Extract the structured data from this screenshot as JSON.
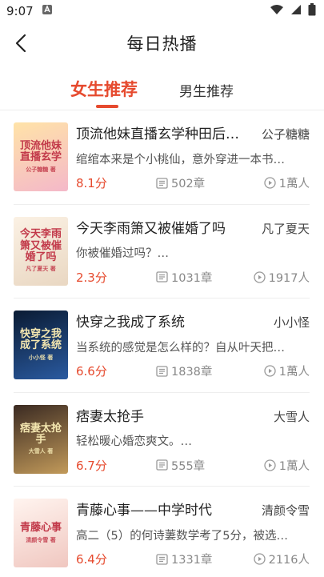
{
  "status": {
    "time": "9:07"
  },
  "header": {
    "title": "每日热播"
  },
  "tabs": [
    {
      "label": "女生推荐",
      "active": true
    },
    {
      "label": "男生推荐",
      "active": false
    }
  ],
  "books": [
    {
      "title": "顶流他妹直播玄学种田后…",
      "author": "公子糖糖",
      "desc": "绾绾本来是个小桃仙，意外穿进一本书…",
      "score": "8.1分",
      "chapters": "502章",
      "reads": "1萬人",
      "cover_title": "顶流他妹直播玄学",
      "cover_sub": "公子糖糖 著",
      "cover_colors": [
        "#ffe3a8",
        "#f4b8c9"
      ]
    },
    {
      "title": "今天李雨箫又被催婚了吗",
      "author": "凡了夏天",
      "desc": "你被催婚过吗？…",
      "score": "2.3分",
      "chapters": "1031章",
      "reads": "1917人",
      "cover_title": "今天李雨箫又被催婚了吗",
      "cover_sub": "凡了夏天 著",
      "cover_colors": [
        "#fbf1e4",
        "#e9d7c2"
      ]
    },
    {
      "title": "快穿之我成了系统",
      "author": "小小怪",
      "desc": "当系统的感觉是怎么样的？自从叶天把…",
      "score": "6.6分",
      "chapters": "1838章",
      "reads": "1萬人",
      "cover_title": "快穿之我成了系统",
      "cover_sub": "小小怪 著",
      "cover_colors": [
        "#0a1b33",
        "#2a5aa0"
      ]
    },
    {
      "title": "痞妻太抢手",
      "author": "大雪人",
      "desc": "轻松暖心婚恋爽文。…",
      "score": "6.7分",
      "chapters": "555章",
      "reads": "1萬人",
      "cover_title": "痞妻太抢手",
      "cover_sub": "大雪人 著",
      "cover_colors": [
        "#3a2a22",
        "#c29a5a"
      ]
    },
    {
      "title": "青藤心事——中学时代",
      "author": "清颜令雪",
      "desc": "高二（5）的何诗萋数学考了5分，被选…",
      "score": "6.4分",
      "chapters": "1331章",
      "reads": "2116人",
      "cover_title": "青藤心事",
      "cover_sub": "清颜令雪 著",
      "cover_colors": [
        "#fff4ef",
        "#f0c7c0"
      ]
    }
  ]
}
